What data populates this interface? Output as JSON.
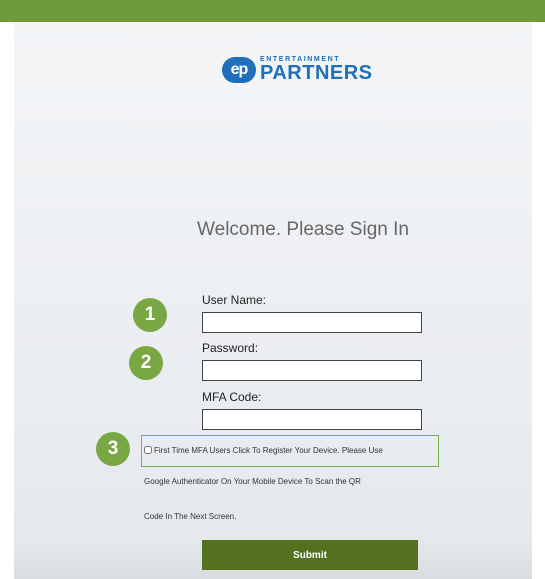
{
  "brand": {
    "mark": "ep",
    "top": "ENTERTAINMENT",
    "name": "PARTNERS"
  },
  "form": {
    "title": "Welcome. Please Sign In",
    "username_label": "User Name:",
    "password_label": "Password:",
    "mfa_label": "MFA Code:",
    "username_value": "",
    "password_value": "",
    "mfa_value": "",
    "register_text_line1": "First Time MFA Users Click To Register Your Device. Please Use",
    "register_text_line2": "Google Authenticator On Your Mobile Device To Scan the QR",
    "register_text_line3": "Code In The Next Screen.",
    "submit_label": "Submit"
  },
  "steps": [
    "1",
    "2",
    "3"
  ],
  "colors": {
    "top_bar": "#6f9a3b",
    "step_badge": "#79a743",
    "submit": "#537120",
    "brand_blue": "#1f6fba"
  }
}
